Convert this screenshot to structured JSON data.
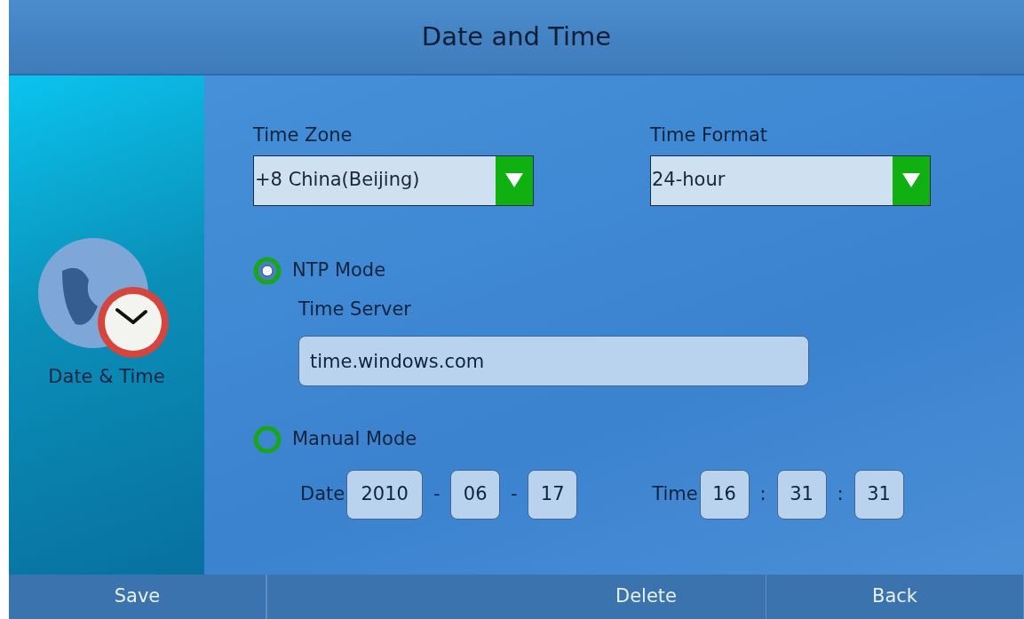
{
  "window": {
    "title": "Date and Time"
  },
  "sidebar": {
    "label": "Date & Time"
  },
  "time_zone": {
    "label": "Time Zone",
    "value": "+8 China(Beijing)"
  },
  "time_format": {
    "label": "Time Format",
    "value": "24-hour"
  },
  "ntp_mode": {
    "label": "NTP Mode",
    "selected": true,
    "server_label": "Time Server",
    "server_value": "time.windows.com"
  },
  "manual_mode": {
    "label": "Manual Mode",
    "selected": false
  },
  "date": {
    "label": "Date",
    "segments": [
      {
        "kind": "field",
        "text": "2010"
      },
      {
        "kind": "sep",
        "text": "-"
      },
      {
        "kind": "field",
        "text": "06"
      },
      {
        "kind": "sep",
        "text": "-"
      },
      {
        "kind": "field",
        "text": "17"
      }
    ]
  },
  "time": {
    "label": "Time",
    "segments": [
      {
        "kind": "field",
        "text": "16"
      },
      {
        "kind": "sep",
        "text": ":"
      },
      {
        "kind": "field",
        "text": "31"
      },
      {
        "kind": "sep",
        "text": ":"
      },
      {
        "kind": "field",
        "text": "31"
      }
    ]
  },
  "softkeys": [
    {
      "label": "Save"
    },
    {
      "label": "Delete"
    },
    {
      "label": "Back"
    }
  ]
}
